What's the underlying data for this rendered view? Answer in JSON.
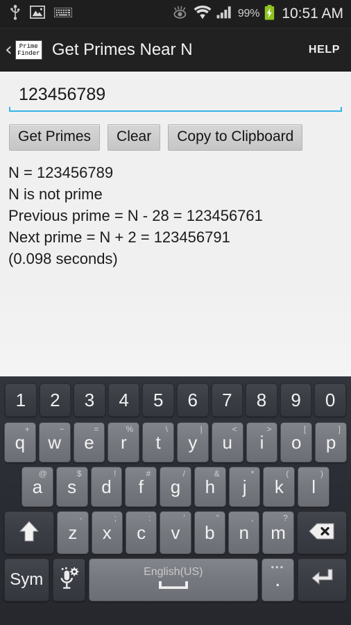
{
  "status_bar": {
    "left_icons": [
      "usb-icon",
      "image-icon",
      "keyboard-icon"
    ],
    "right_icons": [
      "smart-stay-eye-icon",
      "wifi-icon",
      "cellular-signal-icon"
    ],
    "battery_percent": "99%",
    "battery_state": "charging",
    "clock": "10:51 AM"
  },
  "action_bar": {
    "back_glyph": "‹",
    "app_icon_line1": "Prime",
    "app_icon_line2": "Finder",
    "title": "Get Primes Near N",
    "help_label": "HELP"
  },
  "main": {
    "input": {
      "value": "123456789",
      "placeholder": ""
    },
    "buttons": [
      {
        "label": "Get Primes"
      },
      {
        "label": "Clear"
      },
      {
        "label": "Copy to Clipboard"
      }
    ],
    "results": [
      "N = 123456789",
      "N is not prime",
      "Previous prime = N - 28 = 123456761",
      "Next prime = N + 2 = 123456791",
      "(0.098 seconds)"
    ]
  },
  "keyboard": {
    "number_row": [
      {
        "main": "1"
      },
      {
        "main": "2"
      },
      {
        "main": "3"
      },
      {
        "main": "4"
      },
      {
        "main": "5"
      },
      {
        "main": "6"
      },
      {
        "main": "7"
      },
      {
        "main": "8"
      },
      {
        "main": "9"
      },
      {
        "main": "0"
      }
    ],
    "row_q": [
      {
        "main": "q",
        "sub": "+"
      },
      {
        "main": "w",
        "sub": "−"
      },
      {
        "main": "e",
        "sub": "="
      },
      {
        "main": "r",
        "sub": "%"
      },
      {
        "main": "t",
        "sub": "\\"
      },
      {
        "main": "y",
        "sub": "|"
      },
      {
        "main": "u",
        "sub": "<"
      },
      {
        "main": "i",
        "sub": ">"
      },
      {
        "main": "o",
        "sub": "["
      },
      {
        "main": "p",
        "sub": "]"
      }
    ],
    "row_a": [
      {
        "main": "a",
        "sub": "@"
      },
      {
        "main": "s",
        "sub": "$"
      },
      {
        "main": "d",
        "sub": "!"
      },
      {
        "main": "f",
        "sub": "#"
      },
      {
        "main": "g",
        "sub": "/"
      },
      {
        "main": "h",
        "sub": "&"
      },
      {
        "main": "j",
        "sub": "*"
      },
      {
        "main": "k",
        "sub": "("
      },
      {
        "main": "l",
        "sub": ")"
      }
    ],
    "row_z": [
      {
        "main": "z",
        "sub": "-"
      },
      {
        "main": "x",
        "sub": ";"
      },
      {
        "main": "c",
        "sub": ":"
      },
      {
        "main": "v",
        "sub": "'"
      },
      {
        "main": "b",
        "sub": "\""
      },
      {
        "main": "n",
        "sub": ","
      },
      {
        "main": "m",
        "sub": "?"
      }
    ],
    "shift_icon": "shift-arrow-icon",
    "backspace_icon": "backspace-icon",
    "sym_label": "Sym",
    "mic_icon": "microphone-settings-icon",
    "space_label": "English(US)",
    "period_key": ".",
    "period_dots": "•••",
    "enter_icon": "enter-return-icon"
  },
  "colors": {
    "accent_underline": "#33b5e5",
    "battery_green": "#8fc31f",
    "content_bg": "#f0f0f0",
    "bar_bg": "#212121"
  }
}
